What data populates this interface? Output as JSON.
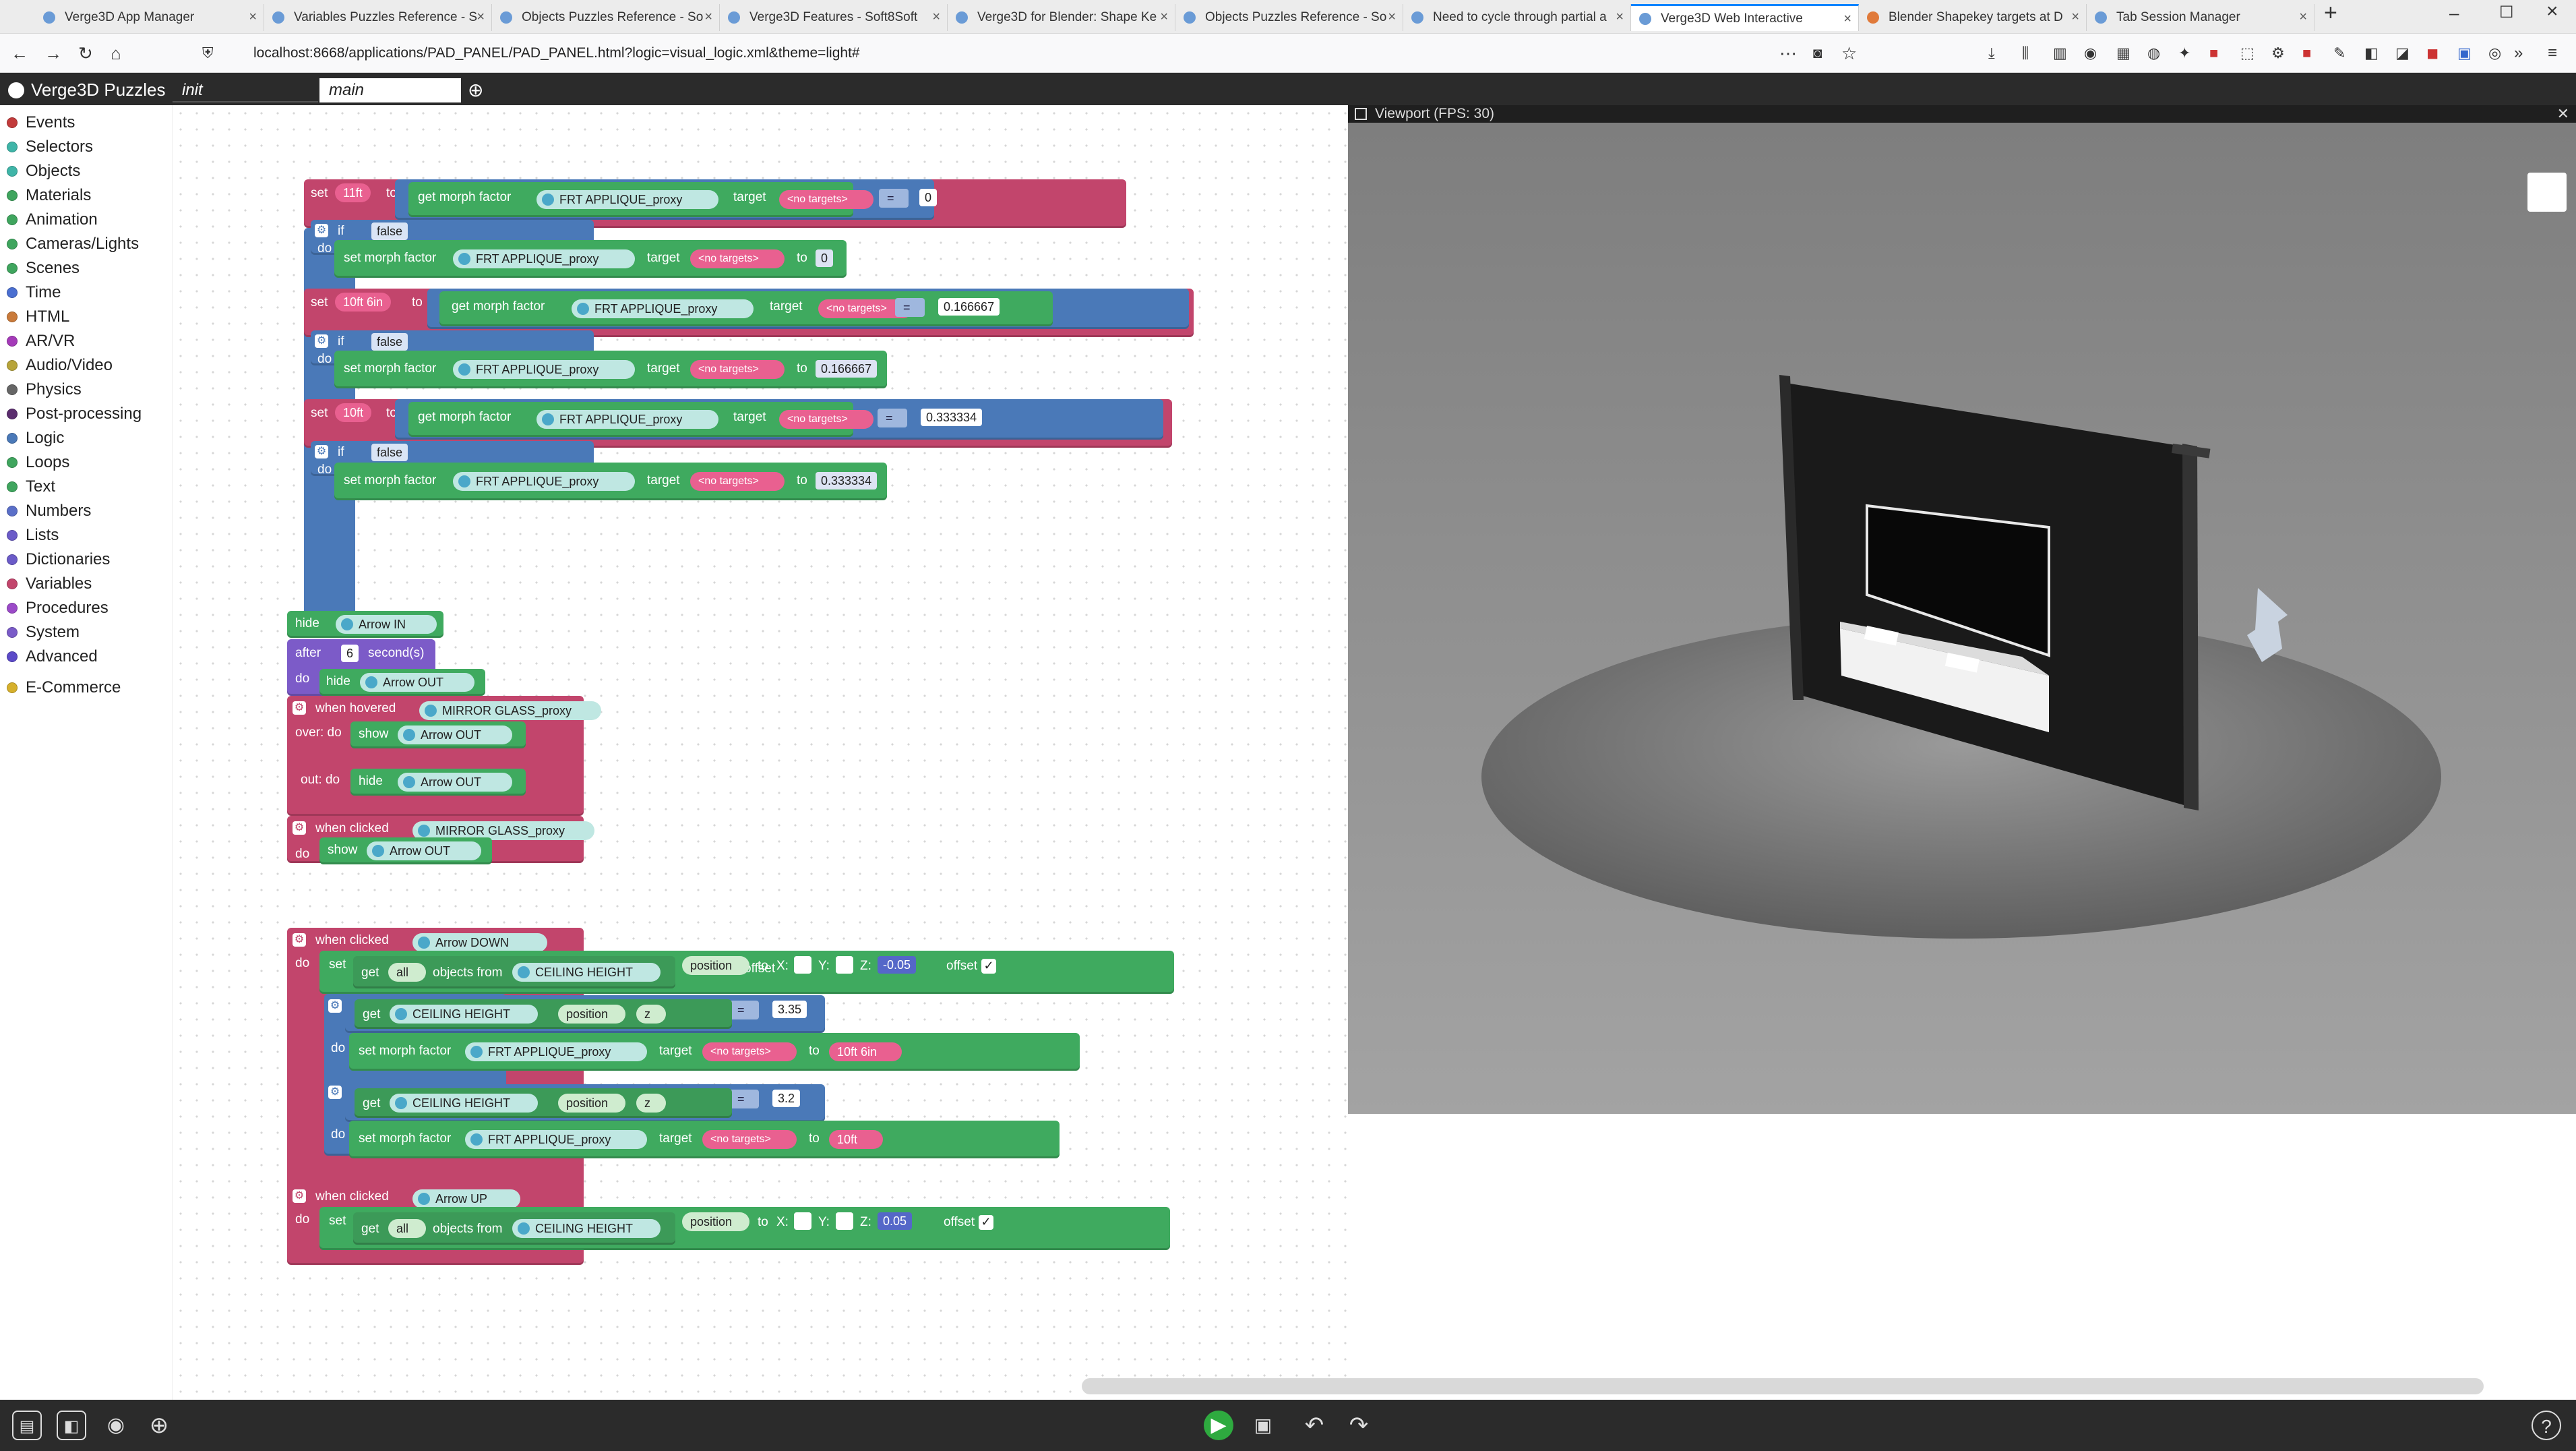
{
  "browser": {
    "tabs": [
      {
        "label": "Verge3D App Manager"
      },
      {
        "label": "Variables Puzzles Reference - S"
      },
      {
        "label": "Objects Puzzles Reference - So"
      },
      {
        "label": "Verge3D Features - Soft8Soft"
      },
      {
        "label": "Verge3D for Blender: Shape Ke"
      },
      {
        "label": "Objects Puzzles Reference - So"
      },
      {
        "label": "Need to cycle through partial a"
      },
      {
        "label": "Verge3D Web Interactive",
        "active": true
      },
      {
        "label": "Blender Shapekey targets at D"
      },
      {
        "label": "Tab Session Manager"
      }
    ],
    "url": "localhost:8668/applications/PAD_PANEL/PAD_PANEL.html?logic=visual_logic.xml&theme=light#"
  },
  "puzzles": {
    "app_title": "Verge3D Puzzles",
    "workspace_tabs": [
      "init",
      "main"
    ],
    "add_tab_icon": "plus-icon"
  },
  "toolbox": {
    "categories": [
      {
        "label": "Events",
        "color": "#c23b3b"
      },
      {
        "label": "Selectors",
        "color": "#3fb5a8"
      },
      {
        "label": "Objects",
        "color": "#3fb5a8"
      },
      {
        "label": "Materials",
        "color": "#3fa55e"
      },
      {
        "label": "Animation",
        "color": "#3fa55e"
      },
      {
        "label": "Cameras/Lights",
        "color": "#3fa55e"
      },
      {
        "label": "Scenes",
        "color": "#3fa55e"
      },
      {
        "label": "Time",
        "color": "#4a6fd1"
      },
      {
        "label": "HTML",
        "color": "#c97a3a"
      },
      {
        "label": "AR/VR",
        "color": "#a43ab8"
      },
      {
        "label": "Audio/Video",
        "color": "#b7a43a"
      },
      {
        "label": "Physics",
        "color": "#666666"
      },
      {
        "label": "Post-processing",
        "color": "#5b2d6e"
      },
      {
        "label": "Logic",
        "color": "#4a79b8"
      },
      {
        "label": "Loops",
        "color": "#3fa55e"
      },
      {
        "label": "Text",
        "color": "#3fa55e"
      },
      {
        "label": "Numbers",
        "color": "#5a6fc8"
      },
      {
        "label": "Lists",
        "color": "#6b5bc8"
      },
      {
        "label": "Dictionaries",
        "color": "#6b5bc8"
      },
      {
        "label": "Variables",
        "color": "#c2456c"
      },
      {
        "label": "Procedures",
        "color": "#9b4ac8"
      },
      {
        "label": "System",
        "color": "#7a5bc8"
      },
      {
        "label": "Advanced",
        "color": "#5b4ac8"
      },
      {
        "label": "E-Commerce",
        "color": "#d6b02c"
      }
    ]
  },
  "blocks": {
    "kw": {
      "set": "set",
      "to": "to",
      "if": "if",
      "do": "do",
      "target": "target",
      "get_morph_factor": "get morph factor",
      "set_morph_factor": "set morph factor",
      "false": "false",
      "eq": "=",
      "hide": "hide",
      "show": "show",
      "after": "after",
      "seconds": "second(s)",
      "when_hovered": "when hovered",
      "over_do": "over: do",
      "out_do": "out: do",
      "when_clicked": "when clicked",
      "get": "get",
      "all": "all",
      "objects_from": "objects from",
      "position": "position",
      "x": "X:",
      "y": "Y:",
      "z": "Z:",
      "offset": "offset",
      "z_axis": "z",
      "no_targets": "<no targets>"
    },
    "morph_object": "FRT APPLIQUE_proxy",
    "group1": {
      "rows": [
        {
          "var": "11ft",
          "compare": "0",
          "morph_value": "0"
        },
        {
          "var": "10ft 6in",
          "compare": "0.166667",
          "morph_value": "0.166667"
        },
        {
          "var": "10ft",
          "compare": "0.333334",
          "morph_value": "0.333334"
        }
      ]
    },
    "group2": {
      "arrow_in": "Arrow IN",
      "delay": "6",
      "arrow_out": "Arrow OUT",
      "mirror": "MIRROR GLASS_proxy"
    },
    "group3": {
      "arrow_down": "Arrow DOWN",
      "arrow_up": "Arrow UP",
      "ceiling": "CEILING HEIGHT",
      "down_z": "-0.05",
      "up_z": "0.05",
      "cmp1": "3.35",
      "var1": "10ft 6in",
      "cmp2": "3.2",
      "var2": "10ft"
    }
  },
  "viewport": {
    "title": "Viewport (FPS: 30)",
    "background": "#8c8c8c"
  },
  "bottom_bar": {
    "left_icons": [
      "toolbox-icon",
      "workspace-icon",
      "screenshot-icon",
      "center-icon"
    ],
    "center_icons": [
      "run-icon",
      "save-icon",
      "undo-icon",
      "redo-icon"
    ],
    "help_icon": "help-icon"
  }
}
